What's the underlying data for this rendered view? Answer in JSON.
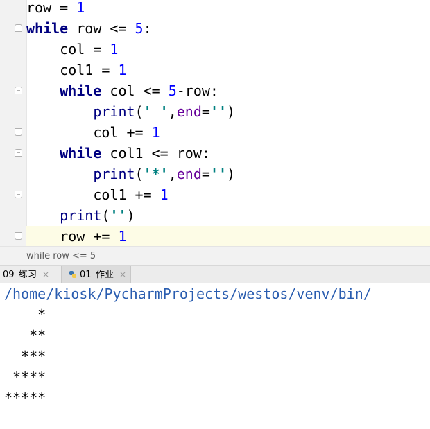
{
  "editor": {
    "lines": [
      {
        "t1": "row = ",
        "t2": "1"
      },
      {
        "kw": "while",
        "rest": " row <= ",
        "num": "5",
        "end": ":"
      },
      {
        "indent": "    ",
        "t1": "col = ",
        "num": "1"
      },
      {
        "indent": "    ",
        "t1": "col1 = ",
        "num": "1"
      },
      {
        "indent": "    ",
        "kw": "while",
        "rest": " col <= ",
        "num": "5",
        "end": "-row:"
      },
      {
        "indent": "        ",
        "fn": "print",
        "p1": "(",
        "str": "' '",
        "comma": ",",
        "param": "end",
        "eq": "=",
        "str2": "''",
        "close": ")"
      },
      {
        "indent": "        ",
        "t1": "col += ",
        "num": "1"
      },
      {
        "indent": "    ",
        "kw": "while",
        "rest": " col1 <= row:"
      },
      {
        "indent": "        ",
        "fn": "print",
        "p1": "(",
        "str": "'*'",
        "comma": ",",
        "param": "end",
        "eq": "=",
        "str2": "''",
        "close": ")"
      },
      {
        "indent": "        ",
        "t1": "col1 += ",
        "num": "1"
      },
      {
        "indent": "    ",
        "fn": "print",
        "p1": "(",
        "str": "''",
        "close": ")"
      },
      {
        "indent": "    ",
        "t1": "row += ",
        "num": "1"
      }
    ]
  },
  "breadcrumb": "while row <= 5",
  "tabs": [
    {
      "label": "09_练习",
      "close": "×"
    },
    {
      "label": "01_作业",
      "close": "×"
    }
  ],
  "console": {
    "path": "/home/kiosk/PycharmProjects/westos/venv/bin/",
    "output": [
      "    *",
      "   **",
      "  ***",
      " ****",
      "*****"
    ]
  },
  "colors": {
    "keyword": "#000080",
    "number": "#0000ff",
    "string": "#008080",
    "param": "#660099",
    "path": "#2a5db0"
  }
}
